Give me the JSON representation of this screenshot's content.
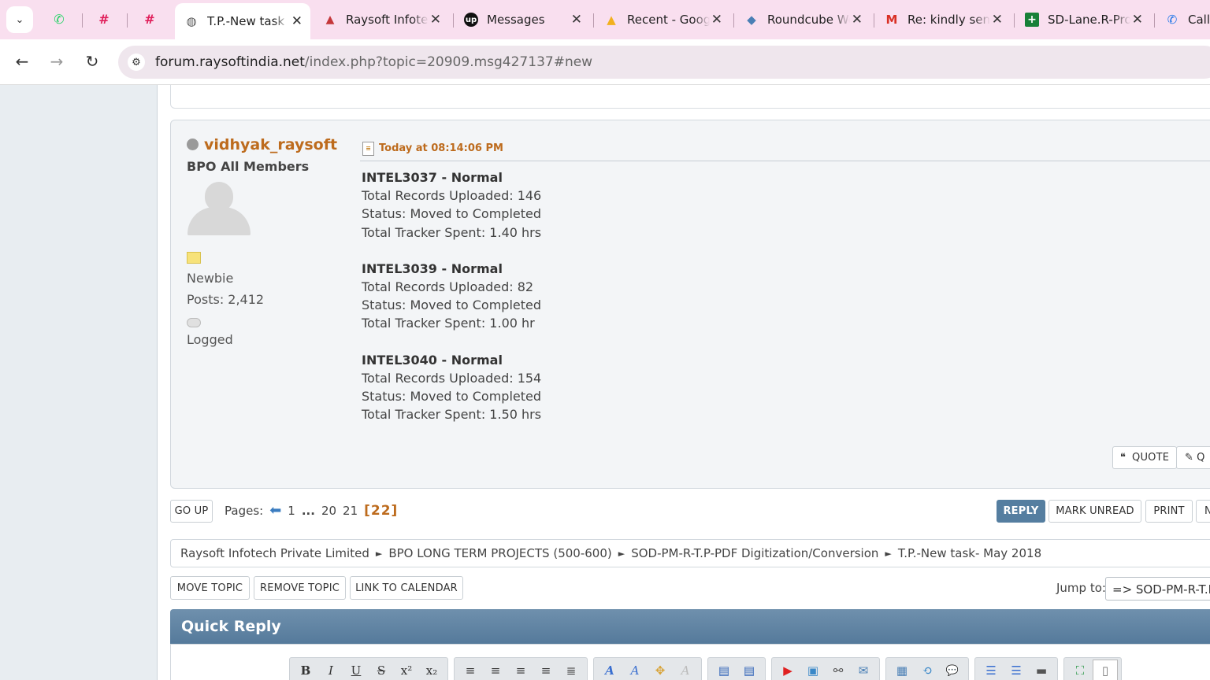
{
  "browser": {
    "tab_dropdown_glyph": "⌄",
    "pinned": [
      {
        "name": "whatsapp-icon",
        "glyph": "✆",
        "color": "#25d366"
      },
      {
        "name": "slack-icon",
        "glyph": "#",
        "color": "#e01e5a"
      },
      {
        "name": "slack-icon-2",
        "glyph": "#",
        "color": "#e01e5a"
      }
    ],
    "tabs": [
      {
        "label": "T.P.-New task",
        "icon_glyph": "◍",
        "icon_color": "#555",
        "active": true
      },
      {
        "label": "Raysoft Infotech",
        "icon_glyph": "▲",
        "icon_color": "#c4373a",
        "active": false
      },
      {
        "label": "Messages",
        "icon_glyph": "up",
        "icon_color": "#ffffff",
        "icon_bg": "#111",
        "active": false
      },
      {
        "label": "Recent - Google",
        "icon_glyph": "▲",
        "icon_color": "#f2b01e",
        "active": false
      },
      {
        "label": "Roundcube Web",
        "icon_glyph": "◆",
        "icon_color": "#4a7fb5",
        "active": false
      },
      {
        "label": "Re: kindly send",
        "icon_glyph": "M",
        "icon_color": "#d93025",
        "active": false
      },
      {
        "label": "SD-Lane.R-Proj",
        "icon_glyph": "+",
        "icon_color": "#ffffff",
        "icon_bg": "#188038",
        "active": false
      },
      {
        "label": "Call",
        "icon_glyph": "✆",
        "icon_color": "#1a73e8",
        "active": false
      }
    ],
    "close_glyph": "✕",
    "back_glyph": "←",
    "forward_glyph": "→",
    "reload_glyph": "↻",
    "site_info_glyph": "⚙",
    "url_host": "forum.raysoftindia.net",
    "url_path": "/index.php?topic=20909.msg427137#new"
  },
  "post": {
    "username": "vidhyak_raysoft",
    "group": "BPO All Members",
    "rank": "Newbie",
    "posts": "Posts: 2,412",
    "logged": "Logged",
    "date": "Today at 08:14:06 PM",
    "entries": [
      {
        "title": "INTEL3037 - Normal",
        "lines": [
          "Total Records Uploaded: 146",
          "Status: Moved to Completed",
          "Total Tracker Spent: 1.40 hrs"
        ]
      },
      {
        "title": "INTEL3039 - Normal",
        "lines": [
          "Total Records Uploaded: 82",
          "Status: Moved to Completed",
          "Total Tracker Spent: 1.00 hr"
        ]
      },
      {
        "title": "INTEL3040 - Normal",
        "lines": [
          "Total Records Uploaded: 154",
          "Status: Moved to Completed",
          "Total Tracker Spent: 1.50 hrs"
        ]
      }
    ],
    "quote_label": "QUOTE",
    "quote_glyph": "❝",
    "quick_edit_label": "Q"
  },
  "pagination": {
    "go_up": "GO UP",
    "label": "Pages:",
    "prev_glyph": "⬅",
    "pages": [
      "1",
      "...",
      "20",
      "21"
    ],
    "current": "[22]"
  },
  "actions": {
    "reply": "REPLY",
    "mark_unread": "MARK UNREAD",
    "print": "PRINT",
    "notify": "N"
  },
  "breadcrumb": {
    "separator": "►",
    "items": [
      "Raysoft Infotech Private Limited",
      "BPO LONG TERM PROJECTS (500-600)",
      "SOD-PM-R-T.P-PDF Digitization/Conversion",
      "T.P.-New task- May 2018"
    ]
  },
  "moderation": {
    "move": "MOVE TOPIC",
    "remove": "REMOVE TOPIC",
    "calendar": "LINK TO CALENDAR"
  },
  "jump": {
    "label": "Jump to:",
    "value": "=> SOD-PM-R-T.P-PDF Digitization/Conversion"
  },
  "quick_reply": {
    "title": "Quick Reply",
    "toolbar": [
      [
        {
          "name": "bold-icon",
          "glyph": "B"
        },
        {
          "name": "italic-icon",
          "glyph": "I"
        },
        {
          "name": "underline-icon",
          "glyph": "U"
        },
        {
          "name": "strikethrough-icon",
          "glyph": "S"
        },
        {
          "name": "superscript-icon",
          "glyph": "x²"
        },
        {
          "name": "subscript-icon",
          "glyph": "x₂"
        }
      ],
      [
        {
          "name": "align-left-icon",
          "glyph": "≡"
        },
        {
          "name": "align-center-icon",
          "glyph": "≡"
        },
        {
          "name": "align-center-2-icon",
          "glyph": "≡"
        },
        {
          "name": "align-right-icon",
          "glyph": "≡"
        },
        {
          "name": "justify-icon",
          "glyph": "≣"
        }
      ],
      [
        {
          "name": "font-icon",
          "glyph": "A"
        },
        {
          "name": "font-size-icon",
          "glyph": "A"
        },
        {
          "name": "color-icon",
          "glyph": "✥"
        },
        {
          "name": "remove-format-icon",
          "glyph": "A"
        }
      ],
      [
        {
          "name": "float-left-icon",
          "glyph": "▤"
        },
        {
          "name": "float-right-icon",
          "glyph": "▤"
        }
      ],
      [
        {
          "name": "youtube-icon",
          "glyph": "▶"
        },
        {
          "name": "image-icon",
          "glyph": "▣"
        },
        {
          "name": "link-icon",
          "glyph": "⚯"
        },
        {
          "name": "email-icon",
          "glyph": "✉"
        }
      ],
      [
        {
          "name": "table-icon",
          "glyph": "▦"
        },
        {
          "name": "code-icon",
          "glyph": "⟲"
        },
        {
          "name": "quote-icon",
          "glyph": "💬"
        }
      ],
      [
        {
          "name": "bullet-list-icon",
          "glyph": "☰"
        },
        {
          "name": "numbered-list-icon",
          "glyph": "☰"
        },
        {
          "name": "hr-icon",
          "glyph": "▬"
        }
      ],
      [
        {
          "name": "maximize-icon",
          "glyph": "⛶"
        },
        {
          "name": "source-icon",
          "glyph": "▯"
        }
      ]
    ]
  }
}
